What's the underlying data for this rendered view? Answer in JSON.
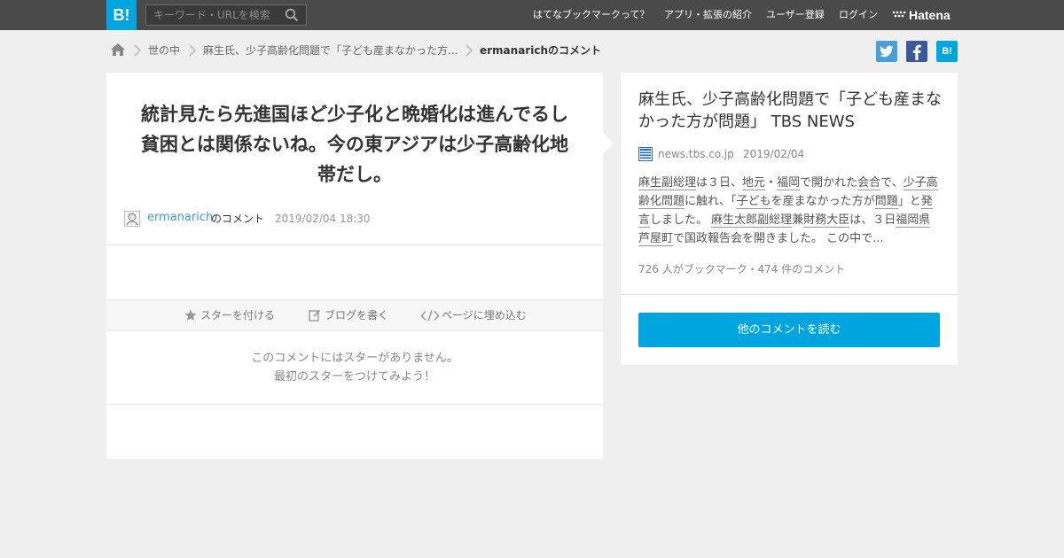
{
  "header": {
    "logo": "B!",
    "search_placeholder": "キーワード・URLを検索",
    "nav": [
      "はてなブックマークって？",
      "アプリ・拡張の紹介",
      "ユーザー登録",
      "ログイン"
    ],
    "brand": "Hatena"
  },
  "breadcrumb": {
    "items": [
      "世の中",
      "麻生氏、少子高齢化問題で「子ども産まなかった方...",
      "ermanarichのコメント"
    ]
  },
  "share": {
    "twitter": "t",
    "facebook": "f",
    "hatena": "B!"
  },
  "comment": {
    "text": "統計見たら先進国ほど少子化と晩婚化は進んでるし貧困とは関係ないね。今の東アジアは少子高齢化地帯だし。",
    "user": "ermanarich",
    "suffix": "のコメント",
    "date": "2019/02/04 18:30"
  },
  "actions": {
    "star": "スターを付ける",
    "blog": "ブログを書く",
    "embed": "ページに埋め込む"
  },
  "stars": {
    "line1": "このコメントにはスターがありません。",
    "line2": "最初のスターをつけてみよう！"
  },
  "entry": {
    "title": "麻生氏、少子高齢化問題で「子ども産まなかった方が問題」 TBS NEWS",
    "domain": "news.tbs.co.jp",
    "date": "2019/02/04",
    "summary": {
      "s1": "麻生副総理",
      "s2": "は３日、",
      "s3": "地元",
      "s4": "・",
      "s5": "福岡",
      "s6": "で開かれた",
      "s7": "会合",
      "s8": "で、",
      "s9": "少子高齢化問題",
      "s10": "に触れ、「",
      "s11": "子ども",
      "s12": "を産まなかった方が",
      "s13": "問題",
      "s14": "」と",
      "s15": "発言",
      "s16": "しました。 ",
      "s17": "麻生太郎",
      "s18": "副総理",
      "s19": "兼",
      "s20": "財務大臣",
      "s21": "は、３日",
      "s22": "福岡県芦屋町",
      "s23": "で国政報告会を開きました。 この中で..."
    },
    "counts": "726 人がブックマーク・474 件のコメント",
    "read_button": "他のコメントを読む"
  },
  "colors": {
    "accent": "#00a4de",
    "topbar": "#4a4a4a",
    "link": "#3c9bd0"
  }
}
